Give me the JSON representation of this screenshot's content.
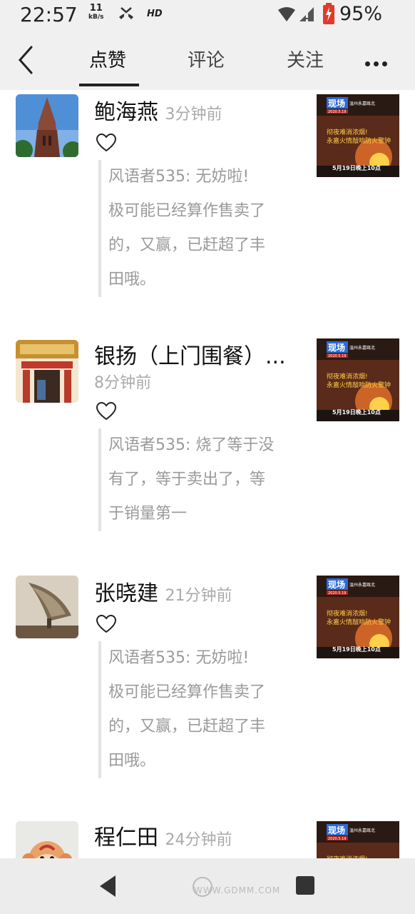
{
  "status_bar": {
    "time": "22:57",
    "net_speed_value": "11",
    "net_speed_unit": "kB/s",
    "hd_label": "HD",
    "battery_percent": "95%"
  },
  "nav": {
    "tabs": [
      {
        "label": "点赞",
        "active": true
      },
      {
        "label": "评论",
        "active": false
      },
      {
        "label": "关注",
        "active": false
      }
    ]
  },
  "items": [
    {
      "name": "鲍海燕",
      "time": "3分钟前",
      "quote_lines": [
        "风语者535: 无妨啦!",
        "极可能已经算作售卖了",
        "的，又赢，已赶超了丰",
        "田哦。"
      ],
      "avatar_icon": "church-tower-photo",
      "thumb_icon": "news-fire-thumbnail"
    },
    {
      "name": "银扬（上门围餐）...",
      "time": "8分钟前",
      "quote_lines": [
        "风语者535: 烧了等于没",
        "有了，等于卖出了，等",
        "于销量第一"
      ],
      "avatar_icon": "restaurant-storefront-photo",
      "thumb_icon": "news-fire-thumbnail"
    },
    {
      "name": "张晓建",
      "time": "21分钟前",
      "quote_lines": [
        "风语者535: 无妨啦!",
        "极可能已经算作售卖了",
        "的，又赢，已赶超了丰",
        "田哦。"
      ],
      "avatar_icon": "gramophone-photo",
      "thumb_icon": "news-fire-thumbnail"
    },
    {
      "name": "程仁田",
      "time": "24分钟前",
      "quote_lines": [],
      "avatar_icon": "monkey-cartoon-photo",
      "thumb_icon": "news-fire-thumbnail"
    }
  ],
  "thumbnail": {
    "badge": "现场",
    "location": "温州永嘉瓯北",
    "date": "2020.5.19",
    "headline_line1": "彻夜难消浓烟!",
    "headline_line2": "永嘉火情敲响防火警钟",
    "footer": "5月19日晚上10点"
  },
  "watermark": {
    "text": "WWW.GDMM.COM"
  },
  "colors": {
    "accent_dark": "#111111",
    "muted_text": "#9a9a9a",
    "thumb_red": "#b3241b",
    "thumb_blue": "#2d6bd6"
  }
}
